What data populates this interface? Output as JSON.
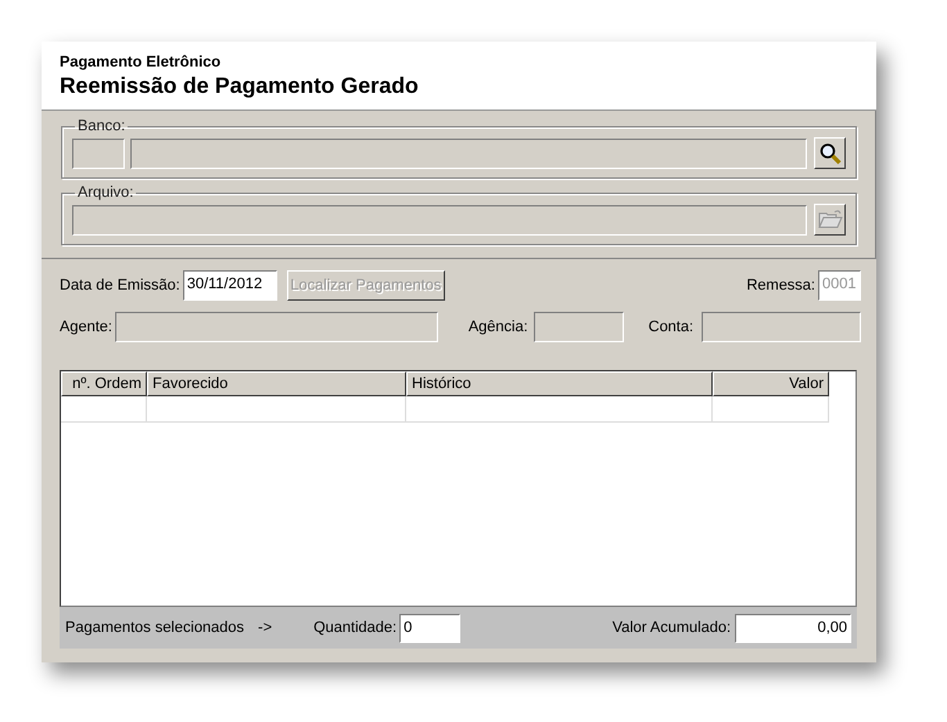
{
  "header": {
    "subtitle": "Pagamento Eletrônico",
    "title": "Reemissão de Pagamento Gerado"
  },
  "banco": {
    "label": "Banco:"
  },
  "arquivo": {
    "label": "Arquivo:"
  },
  "emissao": {
    "label": "Data de Emissão:",
    "value": "30/11/2012",
    "button": {
      "label": "Localizar Pagamentos",
      "disabled": true
    }
  },
  "remessa": {
    "label": "Remessa:",
    "value": "0001",
    "disabled": true
  },
  "agente": {
    "label": "Agente:"
  },
  "agencia": {
    "label": "Agência:"
  },
  "conta": {
    "label": "Conta:"
  },
  "table": {
    "columns": [
      {
        "label": "nº. Ordem"
      },
      {
        "label": "Favorecido"
      },
      {
        "label": "Histórico"
      },
      {
        "label": "Valor"
      }
    ]
  },
  "footer": {
    "caption": "Pagamentos selecionados",
    "arrow": "->",
    "quantidade_label": "Quantidade:",
    "quantidade": "0",
    "valor_label": "Valor Acumulado:",
    "valor": "0,00"
  }
}
